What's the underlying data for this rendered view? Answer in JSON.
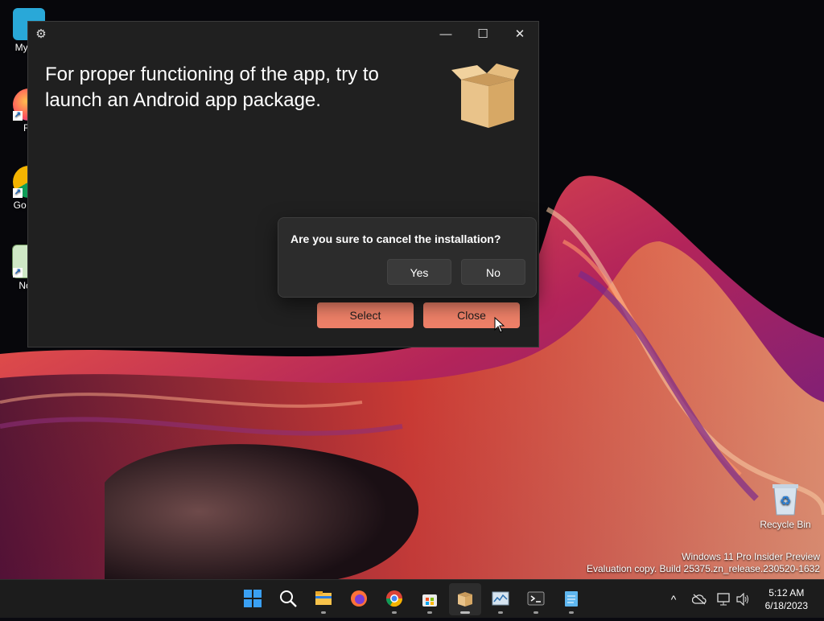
{
  "desktop": {
    "icons": [
      {
        "label": "My Co",
        "icon": "computer-icon"
      },
      {
        "label": "Fir",
        "icon": "firefox-icon"
      },
      {
        "label": "Go Chr",
        "icon": "chrome-icon"
      },
      {
        "label": "Note",
        "icon": "notepad-icon"
      }
    ],
    "recycle_bin": "Recycle Bin",
    "watermark_line1": "Windows 11 Pro Insider Preview",
    "watermark_line2": "Evaluation copy. Build 25375.zn_release.230520-1632"
  },
  "window": {
    "headline": "For proper functioning of the app, try to launch an Android app package.",
    "select_label": "Select",
    "close_label": "Close",
    "minimize_glyph": "—",
    "maximize_glyph": "☐",
    "close_glyph": "✕",
    "settings_glyph": "⚙"
  },
  "dialog": {
    "question": "Are you sure to cancel the installation?",
    "yes_label": "Yes",
    "no_label": "No"
  },
  "taskbar": {
    "items": [
      "start-icon",
      "search-icon",
      "file-explorer-icon",
      "firefox-icon",
      "chrome-icon",
      "store-icon",
      "package-installer-icon",
      "resource-monitor-icon",
      "terminal-icon",
      "notepad-icon"
    ],
    "tray_chevron": "^",
    "time": "5:12 AM",
    "date": "6/18/2023"
  },
  "colors": {
    "accent": "#ee8068",
    "window_bg": "#202020",
    "flyout_bg": "#2c2c2c"
  }
}
